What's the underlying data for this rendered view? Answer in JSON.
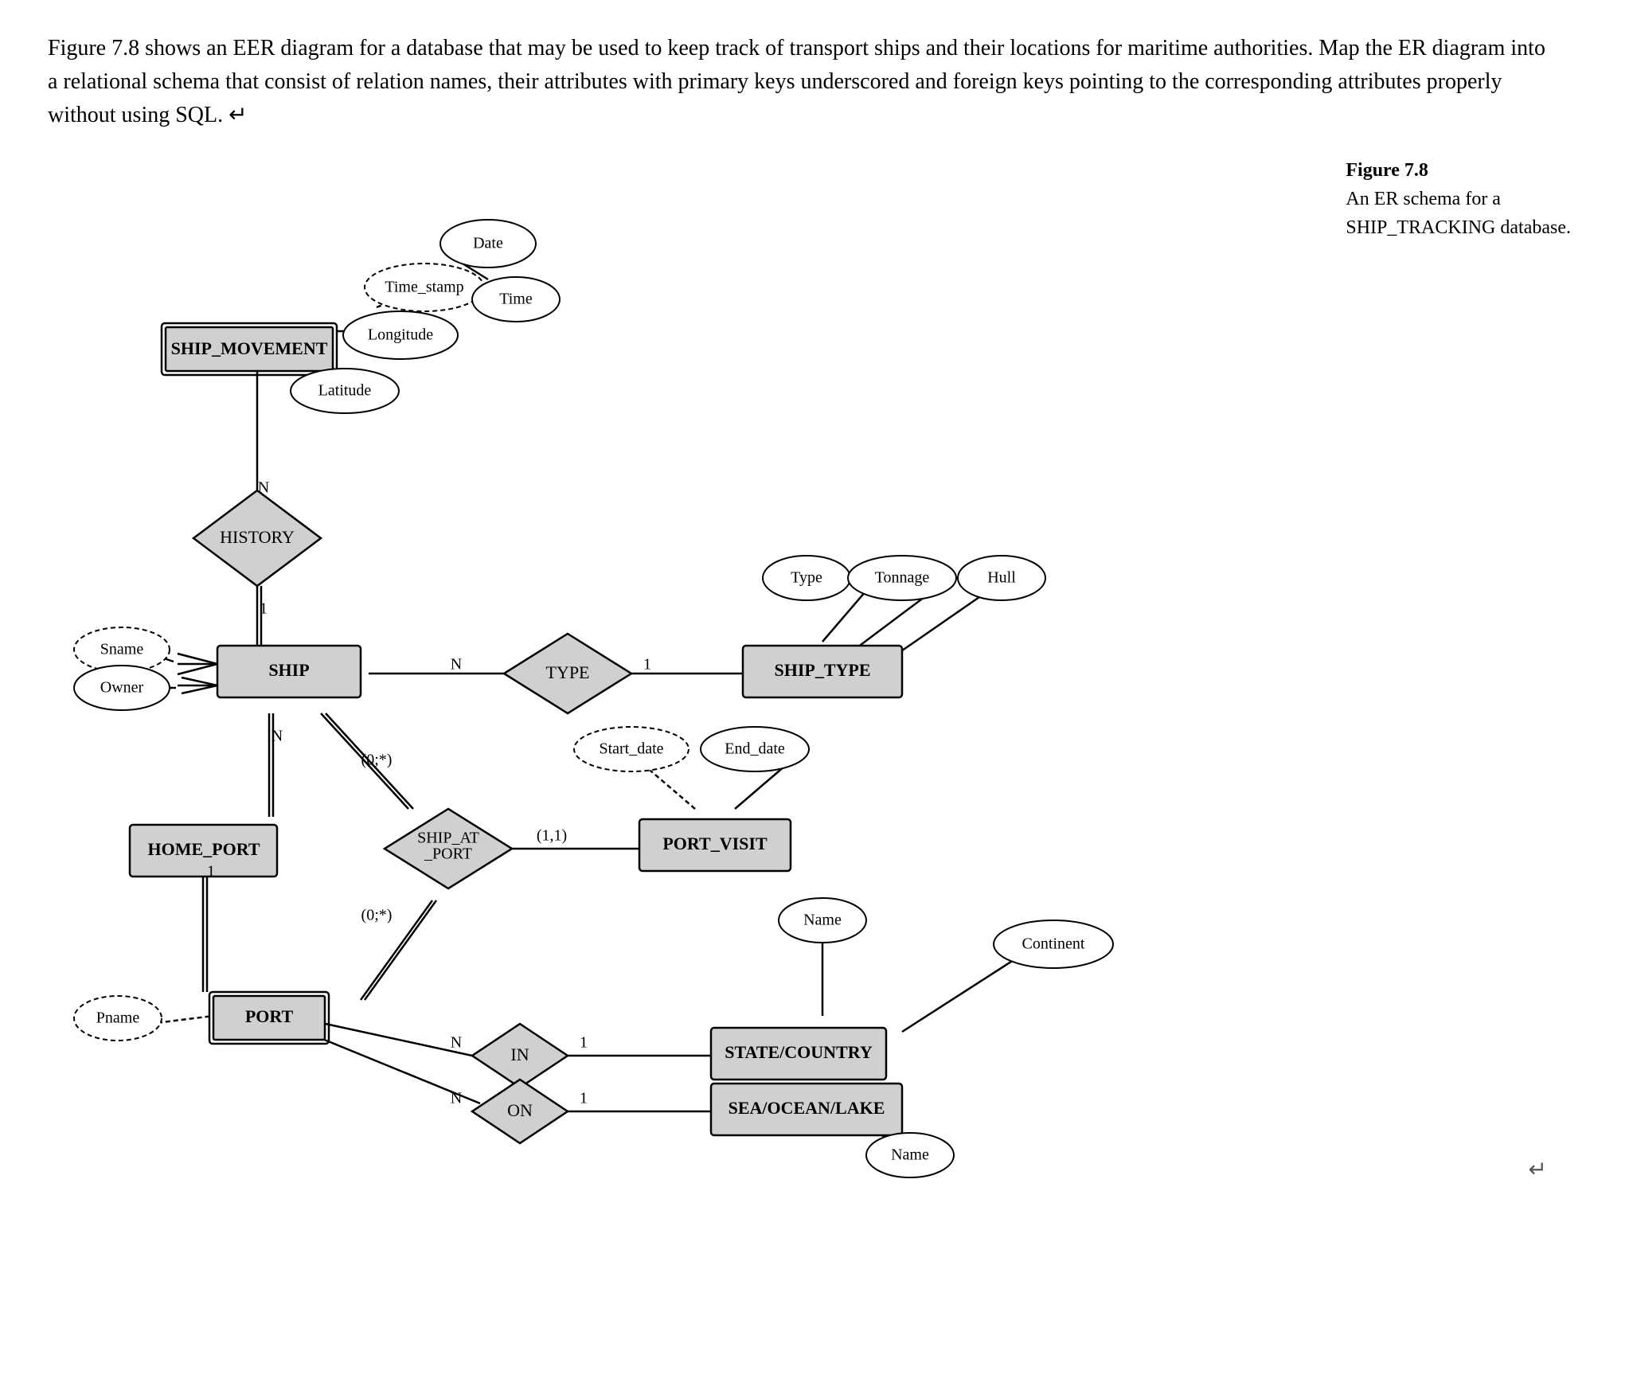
{
  "intro": {
    "text": "Figure 7.8 shows an EER diagram for a database that may be used to keep track of transport ships and their locations for maritime authorities. Map the ER diagram into a relational schema that consist of relation names, their attributes with primary keys underscored and foreign keys pointing to the corresponding attributes properly without using SQL. ↵"
  },
  "figure_caption": {
    "title": "Figure 7.8",
    "subtitle": "An ER schema for a",
    "subtitle2": "SHIP_TRACKING database."
  },
  "entities": {
    "ship_movement": "SHIP_MOVEMENT",
    "ship": "SHIP",
    "ship_type": "SHIP_TYPE",
    "port": "PORT",
    "port_visit": "PORT_VISIT",
    "home_port": "HOME_PORT",
    "state_country": "STATE/COUNTRY",
    "sea_ocean_lake": "SEA/OCEAN/LAKE"
  },
  "relationships": {
    "history": "HISTORY",
    "type": "TYPE",
    "ship_at_port": "SHIP_AT\n_PORT",
    "in": "IN",
    "on": "ON"
  },
  "attributes": {
    "date": "Date",
    "time_stamp": "Time_stamp",
    "time": "Time",
    "longitude": "Longitude",
    "latitude": "Latitude",
    "sname": "Sname",
    "owner": "Owner",
    "hull": "Hull",
    "tonnage": "Tonnage",
    "type_attr": "Type",
    "start_date": "Start_date",
    "end_date": "End_date",
    "continent": "Continent",
    "name_state": "Name",
    "name_sea": "Name",
    "pname": "Pname"
  },
  "cardinalities": {
    "n1": "N",
    "one1": "1",
    "n2": "N",
    "one2": "1",
    "n3": "N",
    "one3": "1",
    "n4": "N",
    "one4": "1",
    "n5": "N",
    "one5": "1",
    "zero_n1": "(0;*)",
    "zero_n2": "(0;*)",
    "one_one": "(1,1)"
  }
}
